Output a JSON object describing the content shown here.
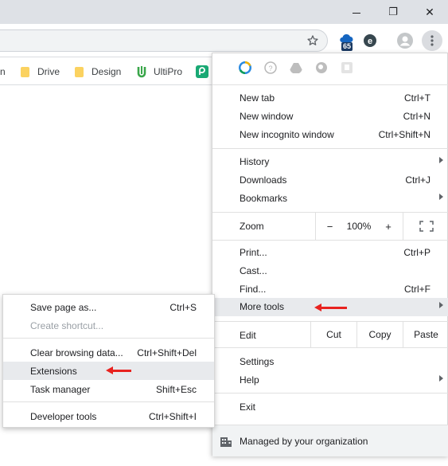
{
  "window": {
    "minimize": "—",
    "restore": "❐",
    "close": "✕"
  },
  "toolbar": {
    "extension_badge": "65",
    "star_icon": "star-icon",
    "profile_icon": "avatar-icon",
    "menu_icon": "three-dots-icon"
  },
  "bookmarks": [
    {
      "label": "n",
      "icon": "folder-icon"
    },
    {
      "label": "Drive",
      "icon": "folder-icon"
    },
    {
      "label": "Design",
      "icon": "folder-icon"
    },
    {
      "label": "UltiPro",
      "icon": "ultipro-icon"
    },
    {
      "label": "",
      "icon": "app-icon"
    }
  ],
  "menu": {
    "new_tab": {
      "label": "New tab",
      "shortcut": "Ctrl+T"
    },
    "new_window": {
      "label": "New window",
      "shortcut": "Ctrl+N"
    },
    "new_incognito": {
      "label": "New incognito window",
      "shortcut": "Ctrl+Shift+N"
    },
    "history": {
      "label": "History"
    },
    "downloads": {
      "label": "Downloads",
      "shortcut": "Ctrl+J"
    },
    "bookmarks": {
      "label": "Bookmarks"
    },
    "zoom": {
      "label": "Zoom",
      "minus": "−",
      "value": "100%",
      "plus": "+",
      "fullscreen_icon": "fullscreen-icon"
    },
    "print": {
      "label": "Print...",
      "shortcut": "Ctrl+P"
    },
    "cast": {
      "label": "Cast..."
    },
    "find": {
      "label": "Find...",
      "shortcut": "Ctrl+F"
    },
    "more_tools": {
      "label": "More tools"
    },
    "edit": {
      "label": "Edit",
      "cut": "Cut",
      "copy": "Copy",
      "paste": "Paste"
    },
    "settings": {
      "label": "Settings"
    },
    "help": {
      "label": "Help"
    },
    "exit": {
      "label": "Exit"
    },
    "managed": {
      "label": "Managed by your organization"
    }
  },
  "submenu": {
    "save_page": {
      "label": "Save page as...",
      "shortcut": "Ctrl+S"
    },
    "create_shortcut": {
      "label": "Create shortcut..."
    },
    "clear_browsing": {
      "label": "Clear browsing data...",
      "shortcut": "Ctrl+Shift+Del"
    },
    "extensions": {
      "label": "Extensions"
    },
    "task_manager": {
      "label": "Task manager",
      "shortcut": "Shift+Esc"
    },
    "dev_tools": {
      "label": "Developer tools",
      "shortcut": "Ctrl+Shift+I"
    }
  },
  "colors": {
    "accent_arrow": "#e8221f",
    "highlight": "#e8eaed",
    "folder": "#fbd260"
  }
}
